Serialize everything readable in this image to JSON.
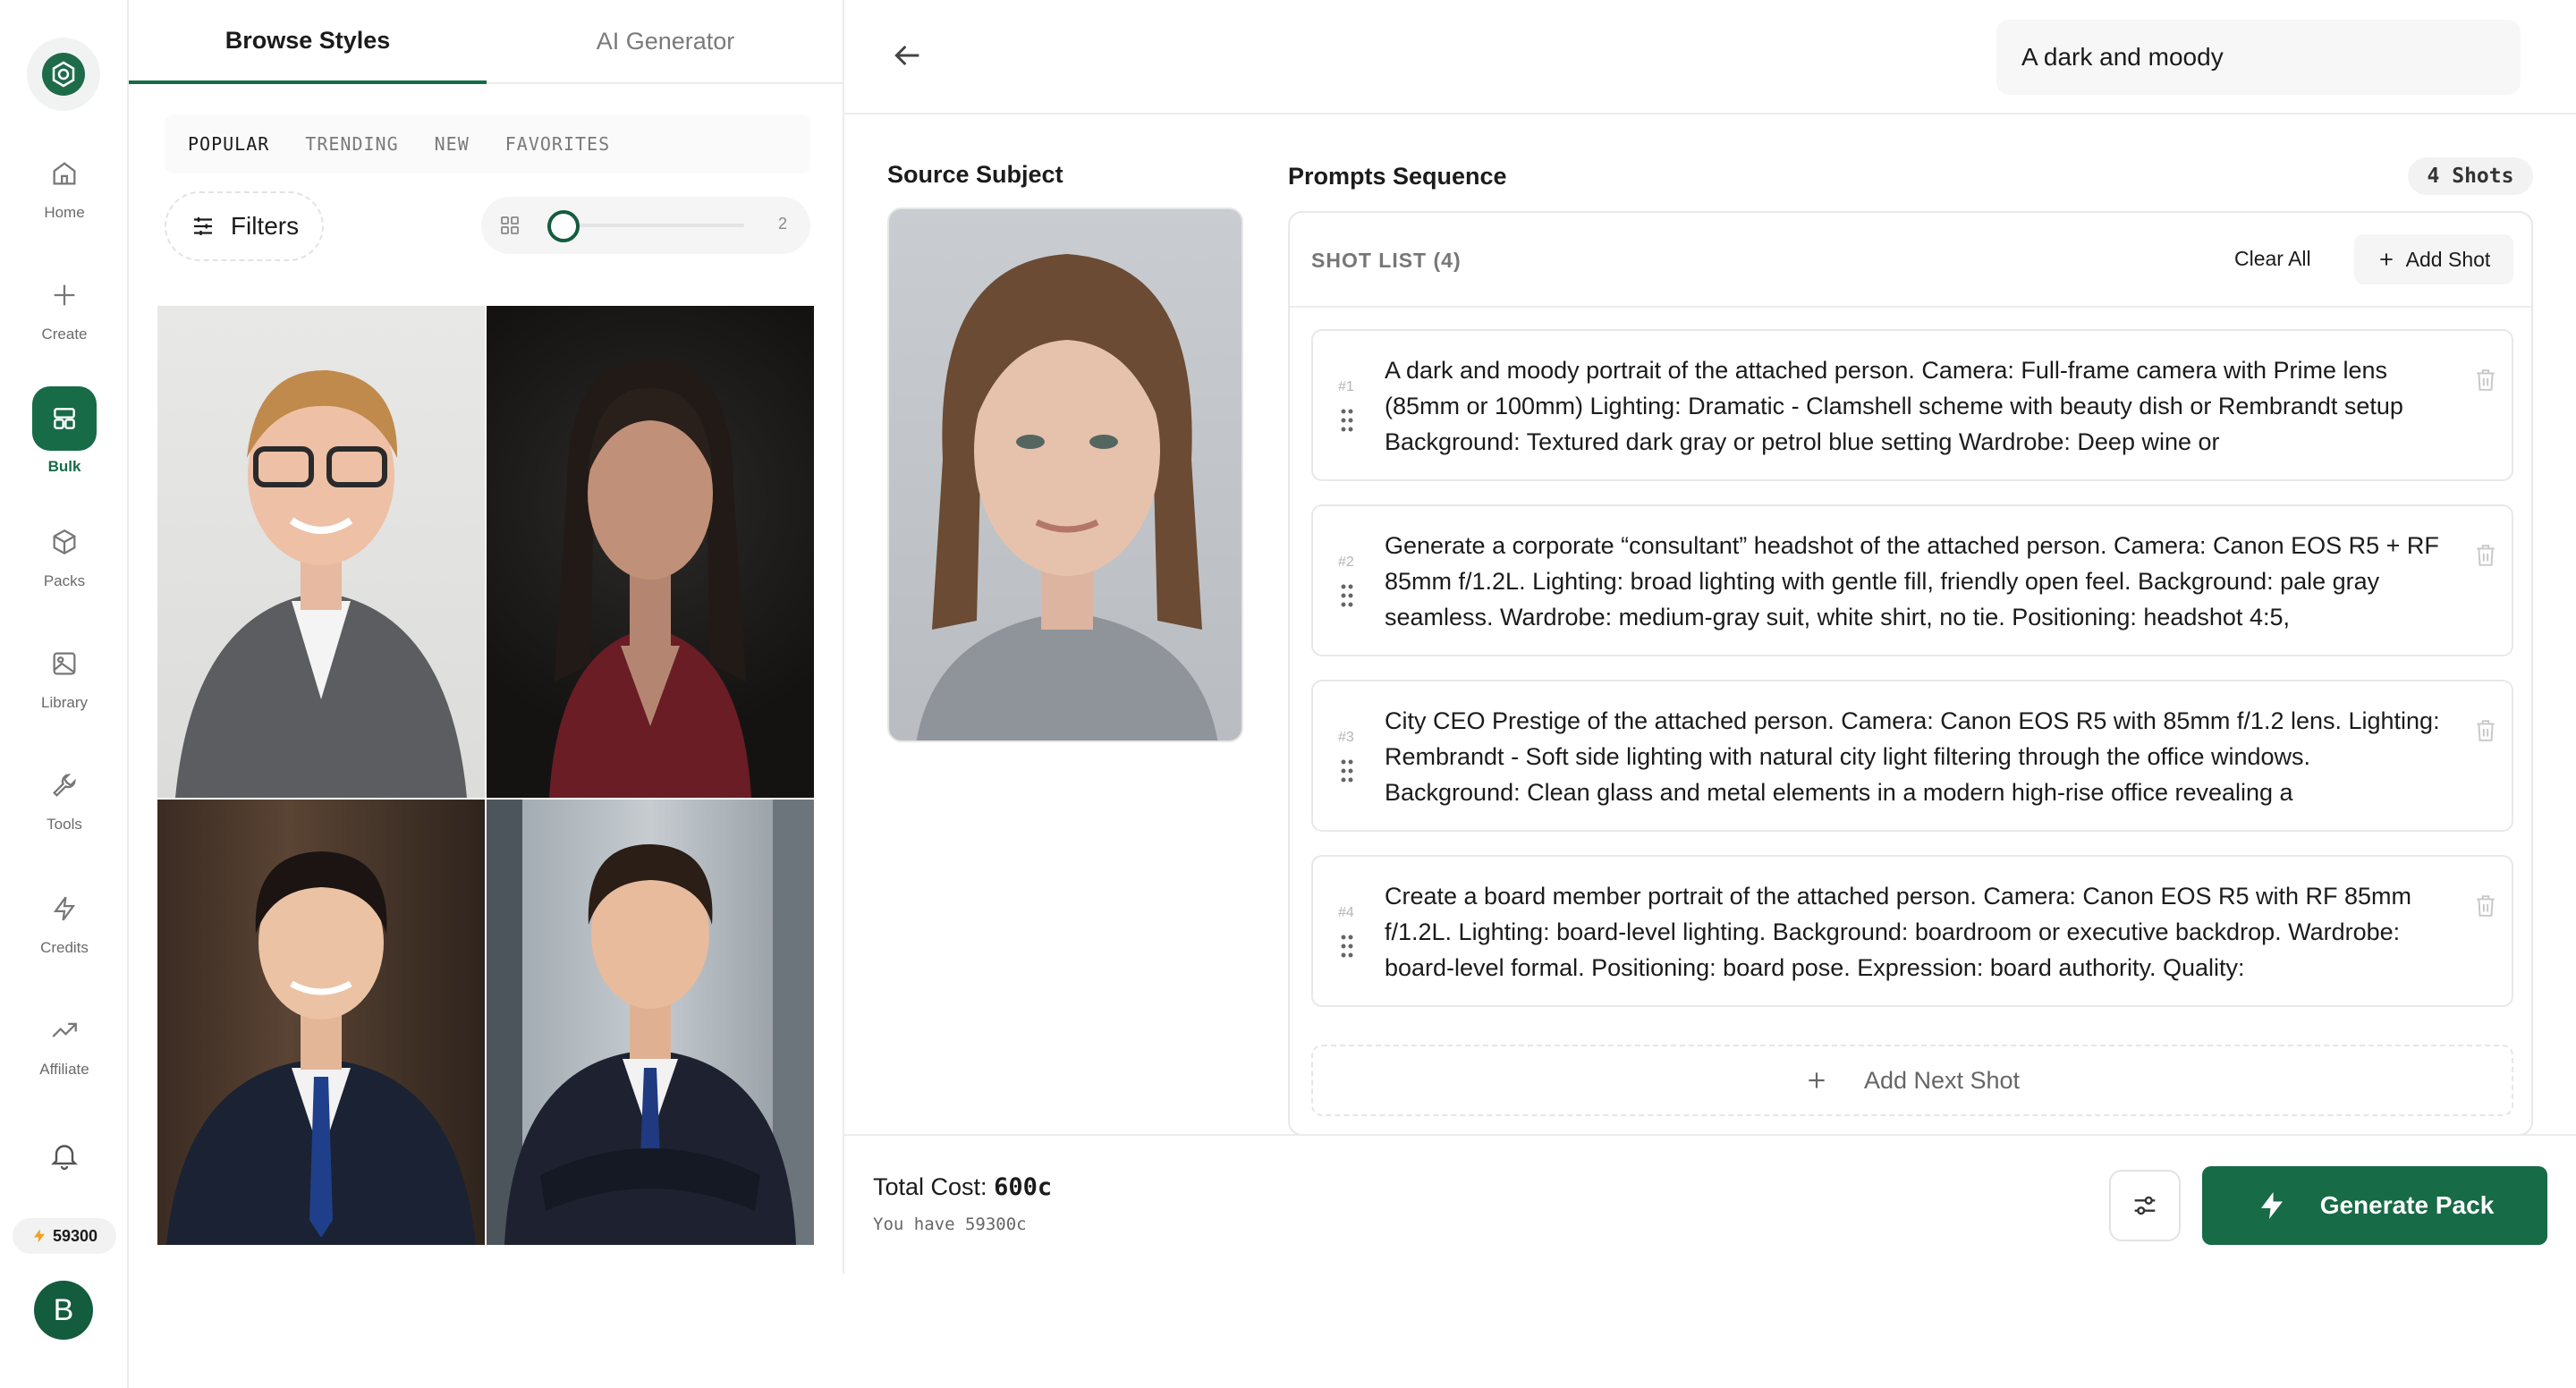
{
  "rail": {
    "items": [
      {
        "label": "Home",
        "icon": "home-icon"
      },
      {
        "label": "Create",
        "icon": "plus-icon"
      },
      {
        "label": "Bulk",
        "icon": "bulk-grid-icon",
        "active": true
      },
      {
        "label": "Packs",
        "icon": "box-icon"
      },
      {
        "label": "Library",
        "icon": "image-icon"
      },
      {
        "label": "Tools",
        "icon": "wrench-icon"
      },
      {
        "label": "Credits",
        "icon": "lightning-icon"
      },
      {
        "label": "Affiliate",
        "icon": "trending-up-icon"
      }
    ],
    "credits": "59300",
    "avatar_letter": "B"
  },
  "styles_panel": {
    "tabs": [
      "Browse Styles",
      "AI Generator"
    ],
    "active_tab": "Browse Styles",
    "categories": [
      "POPULAR",
      "TRENDING",
      "NEW",
      "FAVORITES"
    ],
    "active_category": "POPULAR",
    "filters_label": "Filters",
    "zoom_value": "2",
    "zoom_level": 0
  },
  "topbar": {
    "search_value": "A dark and moody"
  },
  "source": {
    "title": "Source Subject"
  },
  "prompts": {
    "title": "Prompts Sequence",
    "shots_badge": "4 Shots",
    "shot_list_label": "SHOT LIST (4)",
    "clear_all": "Clear All",
    "add_shot": "Add Shot",
    "add_next": "Add Next Shot",
    "shots": [
      {
        "num": "#1",
        "text": "A dark and moody portrait of the attached person. Camera: Full-frame camera with Prime lens (85mm or 100mm) Lighting: Dramatic - Clamshell scheme with beauty dish or Rembrandt setup Background: Textured dark gray or petrol blue setting Wardrobe: Deep wine or"
      },
      {
        "num": "#2",
        "text": "Generate a corporate “consultant” headshot of the attached person. Camera: Canon EOS R5 + RF 85mm f/1.2L. Lighting: broad lighting with gentle fill, friendly open feel. Background: pale gray seamless. Wardrobe: medium-gray suit, white shirt, no tie. Positioning: headshot 4:5,"
      },
      {
        "num": "#3",
        "text": "City CEO Prestige of the attached person. Camera: Canon EOS R5 with 85mm f/1.2 lens. Lighting: Rembrandt - Soft side lighting with natural city light filtering through the office windows. Background: Clean glass and metal elements in a modern high-rise office revealing a"
      },
      {
        "num": "#4",
        "text": "Create a board member portrait of the attached person. Camera: Canon EOS R5 with RF 85mm f/1.2L. Lighting: board-level lighting. Background: boardroom or executive backdrop. Wardrobe: board-level formal. Positioning: board pose. Expression: board authority. Quality:"
      }
    ]
  },
  "footer": {
    "total_label": "Total Cost:",
    "total_value": "600c",
    "have_text": "You have 59300c",
    "generate_label": "Generate Pack"
  },
  "colors": {
    "brand": "#176b47",
    "brand_dark": "#145c3e"
  }
}
